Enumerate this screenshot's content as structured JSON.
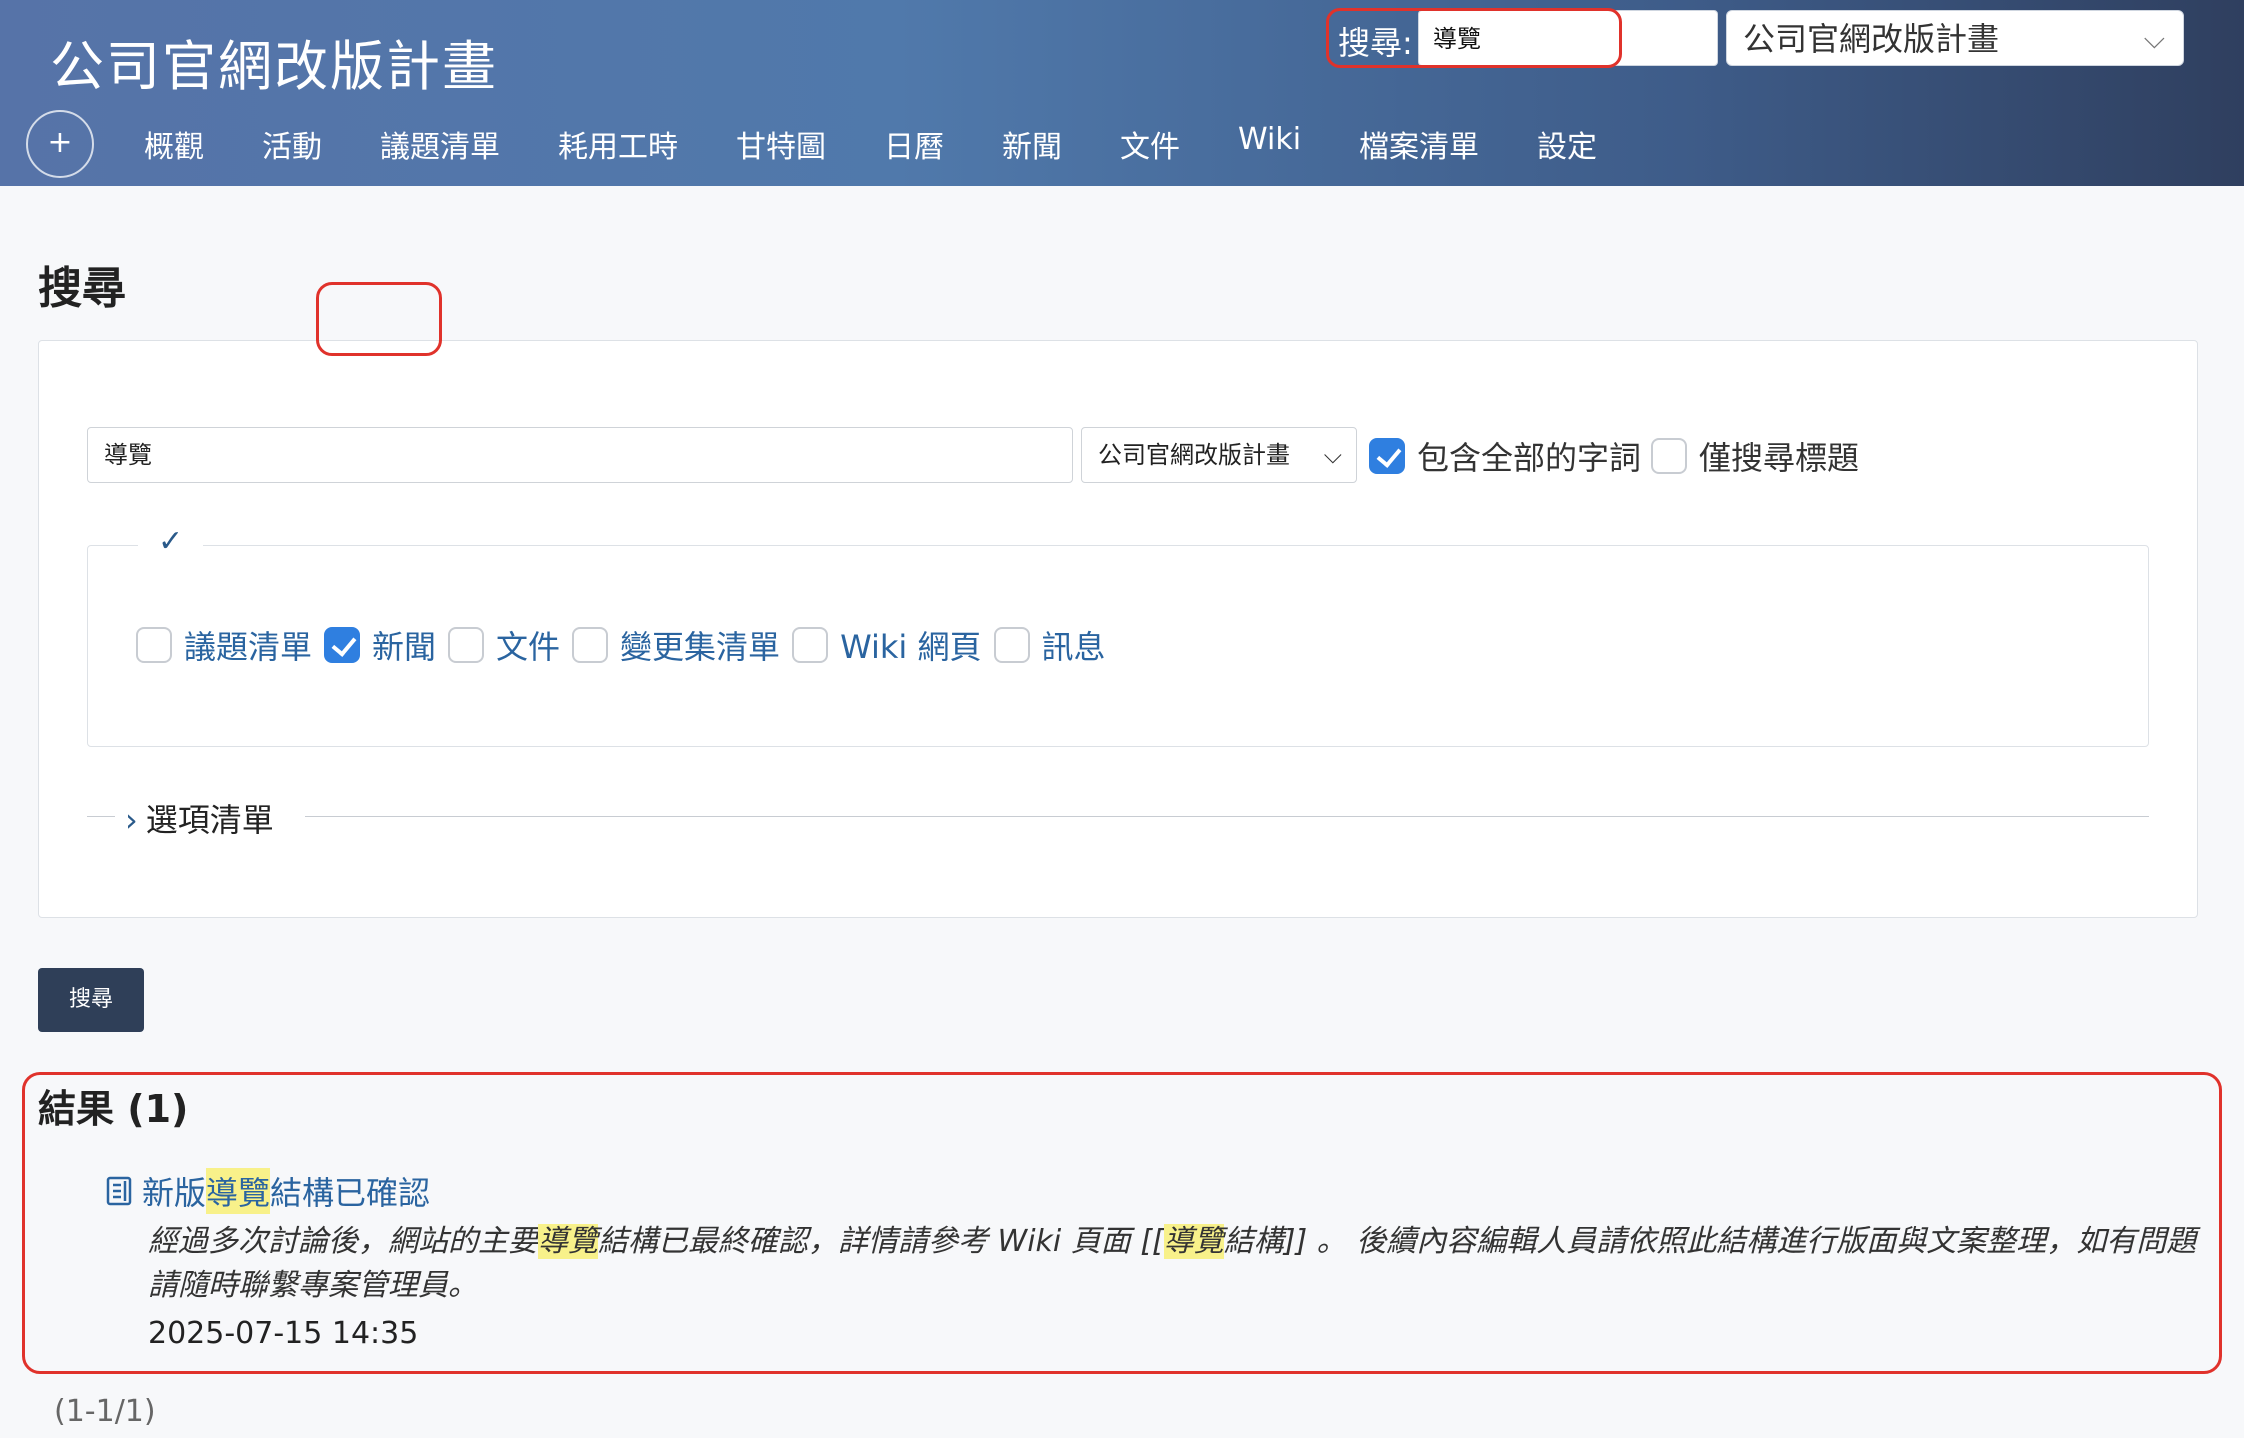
{
  "header": {
    "app_title": "公司官網改版計畫",
    "search_label": "搜尋:",
    "search_value": "導覽",
    "project_select": "公司官網改版計畫",
    "plus_label": "+",
    "nav": [
      "概觀",
      "活動",
      "議題清單",
      "耗用工時",
      "甘特圖",
      "日曆",
      "新聞",
      "文件",
      "Wiki",
      "檔案清單",
      "設定"
    ]
  },
  "page": {
    "title": "搜尋"
  },
  "search_form": {
    "query_value": "導覽",
    "scope_select": "公司官網改版計畫",
    "all_words_label": "包含全部的字詞",
    "all_words_checked": true,
    "titles_only_label": "僅搜尋標題",
    "titles_only_checked": false,
    "legend_mark": "✓",
    "scopes": [
      {
        "label": "議題清單",
        "checked": false
      },
      {
        "label": "新聞",
        "checked": true
      },
      {
        "label": "文件",
        "checked": false
      },
      {
        "label": "變更集清單",
        "checked": false
      },
      {
        "label": "Wiki 網頁",
        "checked": false
      },
      {
        "label": "訊息",
        "checked": false
      }
    ],
    "options_label": "選項清單",
    "submit_label": "搜尋"
  },
  "results": {
    "heading": "結果 (1)",
    "items": [
      {
        "title_pre": "新版",
        "title_hl": "導覽",
        "title_post": "結構已確認",
        "desc_1": "經過多次討論後，網站的主要",
        "desc_hl1": "導覽",
        "desc_2": "結構已最終確認，詳情請參考 Wiki 頁面 [[",
        "desc_hl2": "導覽",
        "desc_3": "結構]] 。 後續內容編輯人員請依照此結構進行版面與文案整理，如有問題請隨時聯繫專案管理員。",
        "date": "2025-07-15 14:35"
      }
    ],
    "pagination": "(1-1/1)"
  },
  "colors": {
    "accent_red": "#e0322b",
    "checkbox_blue": "#2f7fe0",
    "link_blue": "#2a64a0"
  }
}
